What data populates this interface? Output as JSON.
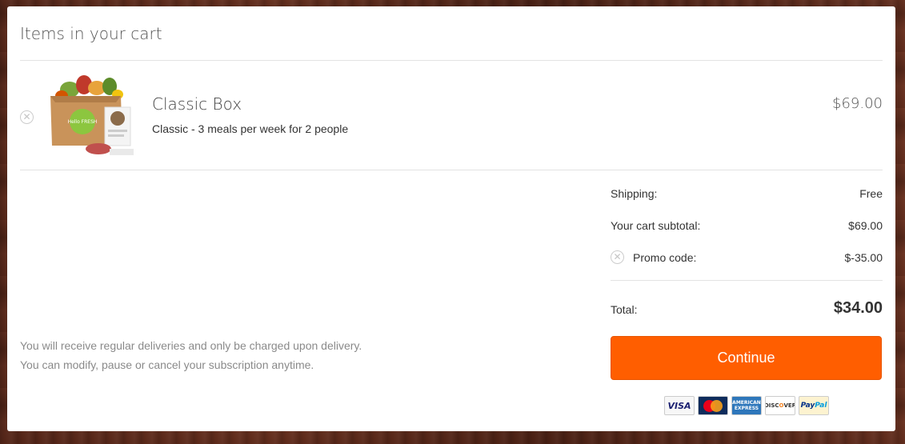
{
  "cart": {
    "heading": "Items in your cart"
  },
  "item": {
    "name": "Classic Box",
    "description": "Classic - 3 meals per week for 2 people",
    "price": "$69.00",
    "image_alt": "HelloFresh box",
    "box_logo": "Hello FRESH"
  },
  "summary": {
    "shipping_label": "Shipping:",
    "shipping_value": "Free",
    "subtotal_label": "Your cart subtotal:",
    "subtotal_value": "$69.00",
    "promo_label": "Promo code:",
    "promo_value": "$-35.00",
    "total_label": "Total:",
    "total_value": "$34.00"
  },
  "continue_label": "Continue",
  "notice": {
    "line1": "You will receive regular deliveries and only be charged upon delivery.",
    "line2": "You can modify, pause or cancel your subscription anytime."
  },
  "payment_methods": {
    "visa": "VISA",
    "amex": "AMERICAN EXPRESS",
    "discover_a": "DISC",
    "discover_b": "O",
    "discover_c": "VER",
    "paypal_a": "Pay",
    "paypal_b": "Pal"
  },
  "icons": {
    "remove_item": "remove-circle-icon",
    "remove_promo": "remove-circle-icon"
  },
  "colors": {
    "accent": "#ff5e00",
    "text": "#333333",
    "muted": "#8a8a8a"
  }
}
